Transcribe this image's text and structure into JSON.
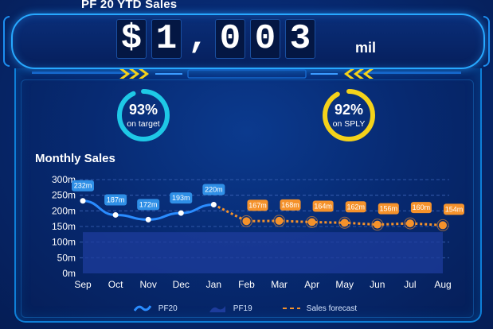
{
  "header": {
    "title": "PF 20 YTD Sales",
    "amount_digits": [
      "$",
      "1",
      ",",
      "0",
      "0",
      "3"
    ],
    "unit": "mil"
  },
  "kpis": [
    {
      "percent": "93%",
      "label": "on target",
      "value": 0.93,
      "color": "#1ec8e6"
    },
    {
      "percent": "92%",
      "label": "on SPLY",
      "value": 0.92,
      "color": "#f4d21a"
    }
  ],
  "chart_data": {
    "type": "line",
    "title": "Monthly Sales",
    "categories": [
      "Sep",
      "Oct",
      "Nov",
      "Dec",
      "Jan",
      "Feb",
      "Mar",
      "Apr",
      "May",
      "Jun",
      "Jul",
      "Aug"
    ],
    "y_ticks": [
      "0m",
      "50m",
      "100m",
      "150m",
      "200m",
      "250m",
      "300m"
    ],
    "ylim": [
      0,
      300
    ],
    "series": [
      {
        "name": "PF20",
        "style": "solid",
        "color": "#2a8cff",
        "values": [
          232,
          187,
          172,
          193,
          220,
          null,
          null,
          null,
          null,
          null,
          null,
          null
        ],
        "labels": [
          "232m",
          "187m",
          "172m",
          "193m",
          "220m",
          "",
          "",
          "",
          "",
          "",
          "",
          ""
        ]
      },
      {
        "name": "PF19",
        "style": "area",
        "color": "#1d3c9c",
        "values": [
          132,
          132,
          132,
          132,
          132,
          132,
          132,
          132,
          132,
          132,
          132,
          132
        ],
        "labels": []
      },
      {
        "name": "Sales forecast",
        "style": "dashed",
        "color": "#f5922b",
        "values": [
          null,
          null,
          null,
          null,
          220,
          167,
          168,
          164,
          162,
          156,
          160,
          154
        ],
        "labels": [
          "",
          "",
          "",
          "",
          "",
          "167m",
          "168m",
          "164m",
          "162m",
          "156m",
          "160m",
          "154m"
        ]
      }
    ],
    "grid": true,
    "legend": "bottom"
  }
}
